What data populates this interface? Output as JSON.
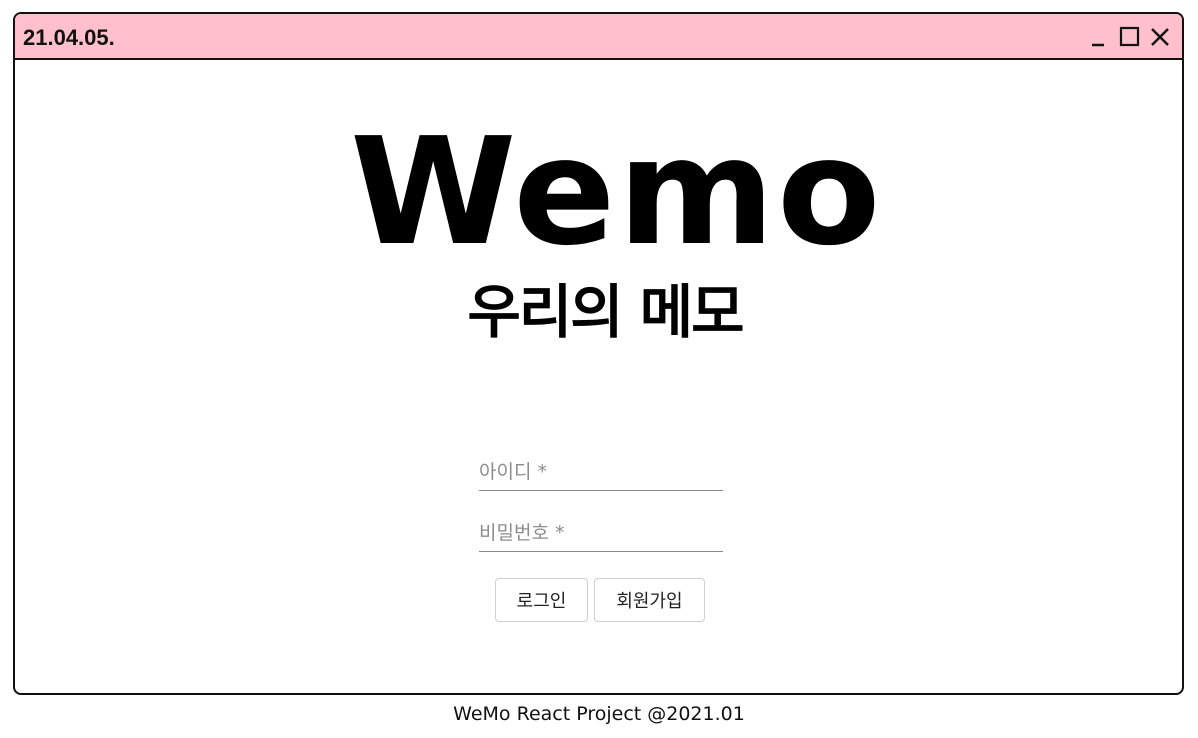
{
  "window": {
    "title": "21.04.05.",
    "title_bg": "#ffc0cb",
    "controls": [
      "minimize-icon",
      "maximize-icon",
      "close-icon"
    ]
  },
  "logo": {
    "main": "Wemo",
    "sub": "우리의 메모"
  },
  "form": {
    "id_placeholder": "아이디 *",
    "id_value": "",
    "password_placeholder": "비밀번호 *",
    "password_value": "",
    "login_label": "로그인",
    "signup_label": "회원가입"
  },
  "footer": {
    "text": "WeMo React Project @2021.01"
  }
}
